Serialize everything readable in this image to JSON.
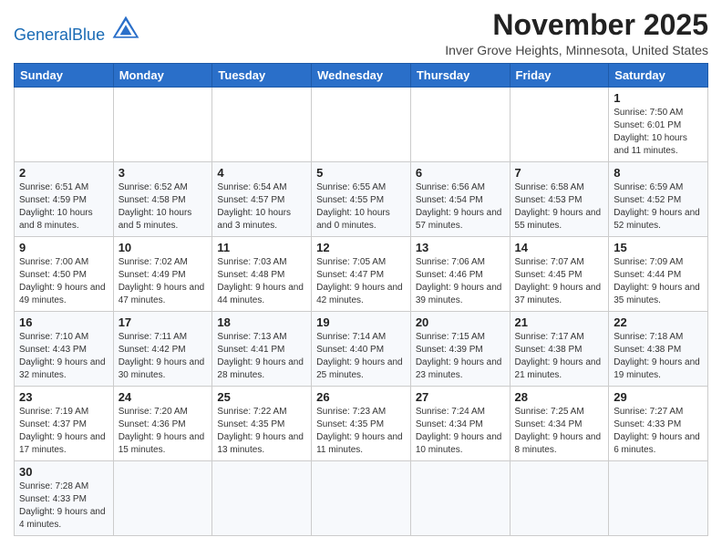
{
  "logo": {
    "text_general": "General",
    "text_blue": "Blue"
  },
  "header": {
    "month": "November 2025",
    "location": "Inver Grove Heights, Minnesota, United States"
  },
  "weekdays": [
    "Sunday",
    "Monday",
    "Tuesday",
    "Wednesday",
    "Thursday",
    "Friday",
    "Saturday"
  ],
  "weeks": [
    [
      {
        "day": "",
        "info": ""
      },
      {
        "day": "",
        "info": ""
      },
      {
        "day": "",
        "info": ""
      },
      {
        "day": "",
        "info": ""
      },
      {
        "day": "",
        "info": ""
      },
      {
        "day": "",
        "info": ""
      },
      {
        "day": "1",
        "info": "Sunrise: 7:50 AM\nSunset: 6:01 PM\nDaylight: 10 hours and 11 minutes."
      }
    ],
    [
      {
        "day": "2",
        "info": "Sunrise: 6:51 AM\nSunset: 4:59 PM\nDaylight: 10 hours and 8 minutes."
      },
      {
        "day": "3",
        "info": "Sunrise: 6:52 AM\nSunset: 4:58 PM\nDaylight: 10 hours and 5 minutes."
      },
      {
        "day": "4",
        "info": "Sunrise: 6:54 AM\nSunset: 4:57 PM\nDaylight: 10 hours and 3 minutes."
      },
      {
        "day": "5",
        "info": "Sunrise: 6:55 AM\nSunset: 4:55 PM\nDaylight: 10 hours and 0 minutes."
      },
      {
        "day": "6",
        "info": "Sunrise: 6:56 AM\nSunset: 4:54 PM\nDaylight: 9 hours and 57 minutes."
      },
      {
        "day": "7",
        "info": "Sunrise: 6:58 AM\nSunset: 4:53 PM\nDaylight: 9 hours and 55 minutes."
      },
      {
        "day": "8",
        "info": "Sunrise: 6:59 AM\nSunset: 4:52 PM\nDaylight: 9 hours and 52 minutes."
      }
    ],
    [
      {
        "day": "9",
        "info": "Sunrise: 7:00 AM\nSunset: 4:50 PM\nDaylight: 9 hours and 49 minutes."
      },
      {
        "day": "10",
        "info": "Sunrise: 7:02 AM\nSunset: 4:49 PM\nDaylight: 9 hours and 47 minutes."
      },
      {
        "day": "11",
        "info": "Sunrise: 7:03 AM\nSunset: 4:48 PM\nDaylight: 9 hours and 44 minutes."
      },
      {
        "day": "12",
        "info": "Sunrise: 7:05 AM\nSunset: 4:47 PM\nDaylight: 9 hours and 42 minutes."
      },
      {
        "day": "13",
        "info": "Sunrise: 7:06 AM\nSunset: 4:46 PM\nDaylight: 9 hours and 39 minutes."
      },
      {
        "day": "14",
        "info": "Sunrise: 7:07 AM\nSunset: 4:45 PM\nDaylight: 9 hours and 37 minutes."
      },
      {
        "day": "15",
        "info": "Sunrise: 7:09 AM\nSunset: 4:44 PM\nDaylight: 9 hours and 35 minutes."
      }
    ],
    [
      {
        "day": "16",
        "info": "Sunrise: 7:10 AM\nSunset: 4:43 PM\nDaylight: 9 hours and 32 minutes."
      },
      {
        "day": "17",
        "info": "Sunrise: 7:11 AM\nSunset: 4:42 PM\nDaylight: 9 hours and 30 minutes."
      },
      {
        "day": "18",
        "info": "Sunrise: 7:13 AM\nSunset: 4:41 PM\nDaylight: 9 hours and 28 minutes."
      },
      {
        "day": "19",
        "info": "Sunrise: 7:14 AM\nSunset: 4:40 PM\nDaylight: 9 hours and 25 minutes."
      },
      {
        "day": "20",
        "info": "Sunrise: 7:15 AM\nSunset: 4:39 PM\nDaylight: 9 hours and 23 minutes."
      },
      {
        "day": "21",
        "info": "Sunrise: 7:17 AM\nSunset: 4:38 PM\nDaylight: 9 hours and 21 minutes."
      },
      {
        "day": "22",
        "info": "Sunrise: 7:18 AM\nSunset: 4:38 PM\nDaylight: 9 hours and 19 minutes."
      }
    ],
    [
      {
        "day": "23",
        "info": "Sunrise: 7:19 AM\nSunset: 4:37 PM\nDaylight: 9 hours and 17 minutes."
      },
      {
        "day": "24",
        "info": "Sunrise: 7:20 AM\nSunset: 4:36 PM\nDaylight: 9 hours and 15 minutes."
      },
      {
        "day": "25",
        "info": "Sunrise: 7:22 AM\nSunset: 4:35 PM\nDaylight: 9 hours and 13 minutes."
      },
      {
        "day": "26",
        "info": "Sunrise: 7:23 AM\nSunset: 4:35 PM\nDaylight: 9 hours and 11 minutes."
      },
      {
        "day": "27",
        "info": "Sunrise: 7:24 AM\nSunset: 4:34 PM\nDaylight: 9 hours and 10 minutes."
      },
      {
        "day": "28",
        "info": "Sunrise: 7:25 AM\nSunset: 4:34 PM\nDaylight: 9 hours and 8 minutes."
      },
      {
        "day": "29",
        "info": "Sunrise: 7:27 AM\nSunset: 4:33 PM\nDaylight: 9 hours and 6 minutes."
      }
    ],
    [
      {
        "day": "30",
        "info": "Sunrise: 7:28 AM\nSunset: 4:33 PM\nDaylight: 9 hours and 4 minutes."
      },
      {
        "day": "",
        "info": ""
      },
      {
        "day": "",
        "info": ""
      },
      {
        "day": "",
        "info": ""
      },
      {
        "day": "",
        "info": ""
      },
      {
        "day": "",
        "info": ""
      },
      {
        "day": "",
        "info": ""
      }
    ]
  ]
}
